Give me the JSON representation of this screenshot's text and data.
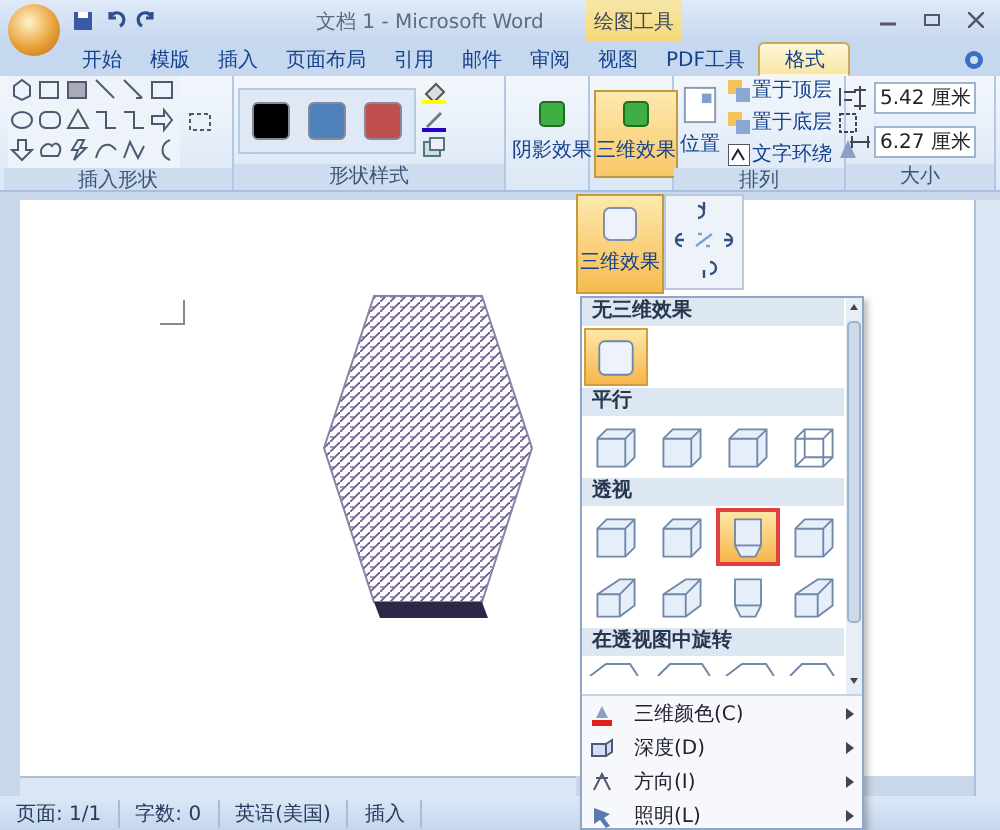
{
  "title_bar": {
    "title": "文档 1 - Microsoft Word",
    "context_label": "绘图工具"
  },
  "tabs": [
    {
      "label": "开始",
      "selected": false
    },
    {
      "label": "模版",
      "selected": false
    },
    {
      "label": "插入",
      "selected": false
    },
    {
      "label": "页面布局",
      "selected": false
    },
    {
      "label": "引用",
      "selected": false
    },
    {
      "label": "邮件",
      "selected": false
    },
    {
      "label": "审阅",
      "selected": false
    },
    {
      "label": "视图",
      "selected": false
    },
    {
      "label": "PDF工具",
      "selected": false
    },
    {
      "label": "格式",
      "selected": true
    }
  ],
  "ribbon": {
    "groups": [
      {
        "kind": "shapes",
        "label": "插入形状"
      },
      {
        "kind": "styles",
        "label": "形状样式",
        "swatches": [
          {
            "color": "#000000"
          },
          {
            "color": "#4f81bd"
          },
          {
            "color": "#c0504d"
          }
        ]
      },
      {
        "kind": "effect",
        "buttons": [
          {
            "label": "阴影效果",
            "selected": false
          }
        ]
      },
      {
        "kind": "effect",
        "buttons": [
          {
            "label": "三维效果",
            "selected": true
          }
        ]
      },
      {
        "kind": "arrange",
        "label": "排列",
        "big_button": "位置",
        "items": [
          "置于顶层",
          "置于底层",
          "文字环绕"
        ]
      },
      {
        "kind": "size",
        "label": "大小",
        "fields": [
          "5.42 厘米",
          "6.27 厘米"
        ]
      }
    ]
  },
  "dropdown": {
    "button_label": "三维效果",
    "sections": [
      {
        "title": "无三维效果",
        "items": [
          {
            "kind": "flat",
            "selected": true,
            "annotated": false
          }
        ]
      },
      {
        "title": "平行",
        "items": [
          {
            "kind": "cube",
            "selected": false,
            "annotated": false
          },
          {
            "kind": "cube",
            "selected": false,
            "annotated": false
          },
          {
            "kind": "cube",
            "selected": false,
            "annotated": false
          },
          {
            "kind": "wire",
            "selected": false,
            "annotated": false
          }
        ]
      },
      {
        "title": "透视",
        "items": [
          {
            "kind": "cube",
            "selected": false,
            "annotated": false
          },
          {
            "kind": "cube",
            "selected": false,
            "annotated": false
          },
          {
            "kind": "front",
            "selected": true,
            "annotated": true
          },
          {
            "kind": "cube",
            "selected": false,
            "annotated": false
          },
          {
            "kind": "slant",
            "selected": false,
            "annotated": false
          },
          {
            "kind": "slant",
            "selected": false,
            "annotated": false
          },
          {
            "kind": "front",
            "selected": false,
            "annotated": false
          },
          {
            "kind": "slant",
            "selected": false,
            "annotated": false
          }
        ]
      },
      {
        "title": "在透视图中旋转"
      }
    ],
    "commands": [
      {
        "label": "三维颜色(C)",
        "kind": "color"
      },
      {
        "label": "深度(D)",
        "kind": "depth"
      },
      {
        "label": "方向(I)",
        "kind": "direction"
      },
      {
        "label": "照明(L)",
        "kind": "light"
      }
    ]
  },
  "status_bar": [
    "页面: 1/1",
    "字数: 0",
    "英语(美国)",
    "插入"
  ]
}
